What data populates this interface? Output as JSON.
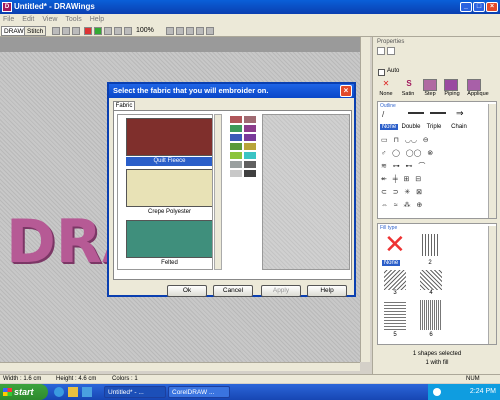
{
  "window": {
    "title": "Untitled* - DRAWings",
    "app_icon": "DRAWings-icon"
  },
  "menu": [
    "File",
    "Edit",
    "View",
    "Tools",
    "Help"
  ],
  "tabs": [
    "DRAW",
    "Stitch"
  ],
  "toolbar": {
    "zoom": "100%"
  },
  "canvas": {
    "embroidery_text": "DRA"
  },
  "dialog": {
    "title": "Select the fabric that you will embroider on.",
    "tab": "Fabric",
    "fabrics": [
      {
        "label": "Quilt Fleece",
        "color": "#7f2f2c",
        "selected": true
      },
      {
        "label": "Crepe Polyester",
        "color": "#e8e2b6",
        "selected": false
      },
      {
        "label": "Felted",
        "color": "#3f8f7c",
        "selected": false
      }
    ],
    "palette": [
      "#b0565a",
      "#a06a72",
      "#3d9a5a",
      "#8c3c8c",
      "#3a59b8",
      "#7a3a9a",
      "#5a9a3a",
      "#b8a43a",
      "#8cc43a",
      "#3ac4c4",
      "#9aa0a0",
      "#606060",
      "#c8c8c8",
      "#404040"
    ],
    "buttons": {
      "ok": "Ok",
      "cancel": "Cancel",
      "apply": "Apply",
      "help": "Help"
    }
  },
  "properties": {
    "title": "Properties",
    "auto_label": "Auto",
    "stitch_types": [
      "None",
      "Satin",
      "Step",
      "Piping",
      "Applique"
    ],
    "outline_label": "Outline",
    "outline_types": [
      "None",
      "Double",
      "Triple",
      "Chain"
    ],
    "outline_extra": [
      "Appl...",
      "C1",
      "C2",
      "C3",
      "C4",
      "C5",
      "C6",
      "C7",
      "C8",
      "C9",
      "C10",
      "C11",
      "C12"
    ],
    "fill_label": "Fill type",
    "fill_items": [
      "None",
      "2",
      "3",
      "4",
      "5",
      "6"
    ],
    "status_line1": "1 shapes selected",
    "status_line2": "1 with fill"
  },
  "statusbar": {
    "width": "Width : 1.6 cm",
    "height": "Height : 4.6 cm",
    "colors": "Colors : 1",
    "num": "NUM"
  },
  "taskbar": {
    "start": "start",
    "items": [
      "Untitled* - ...",
      "CorelDRAW ..."
    ],
    "time": "2:24 PM"
  }
}
